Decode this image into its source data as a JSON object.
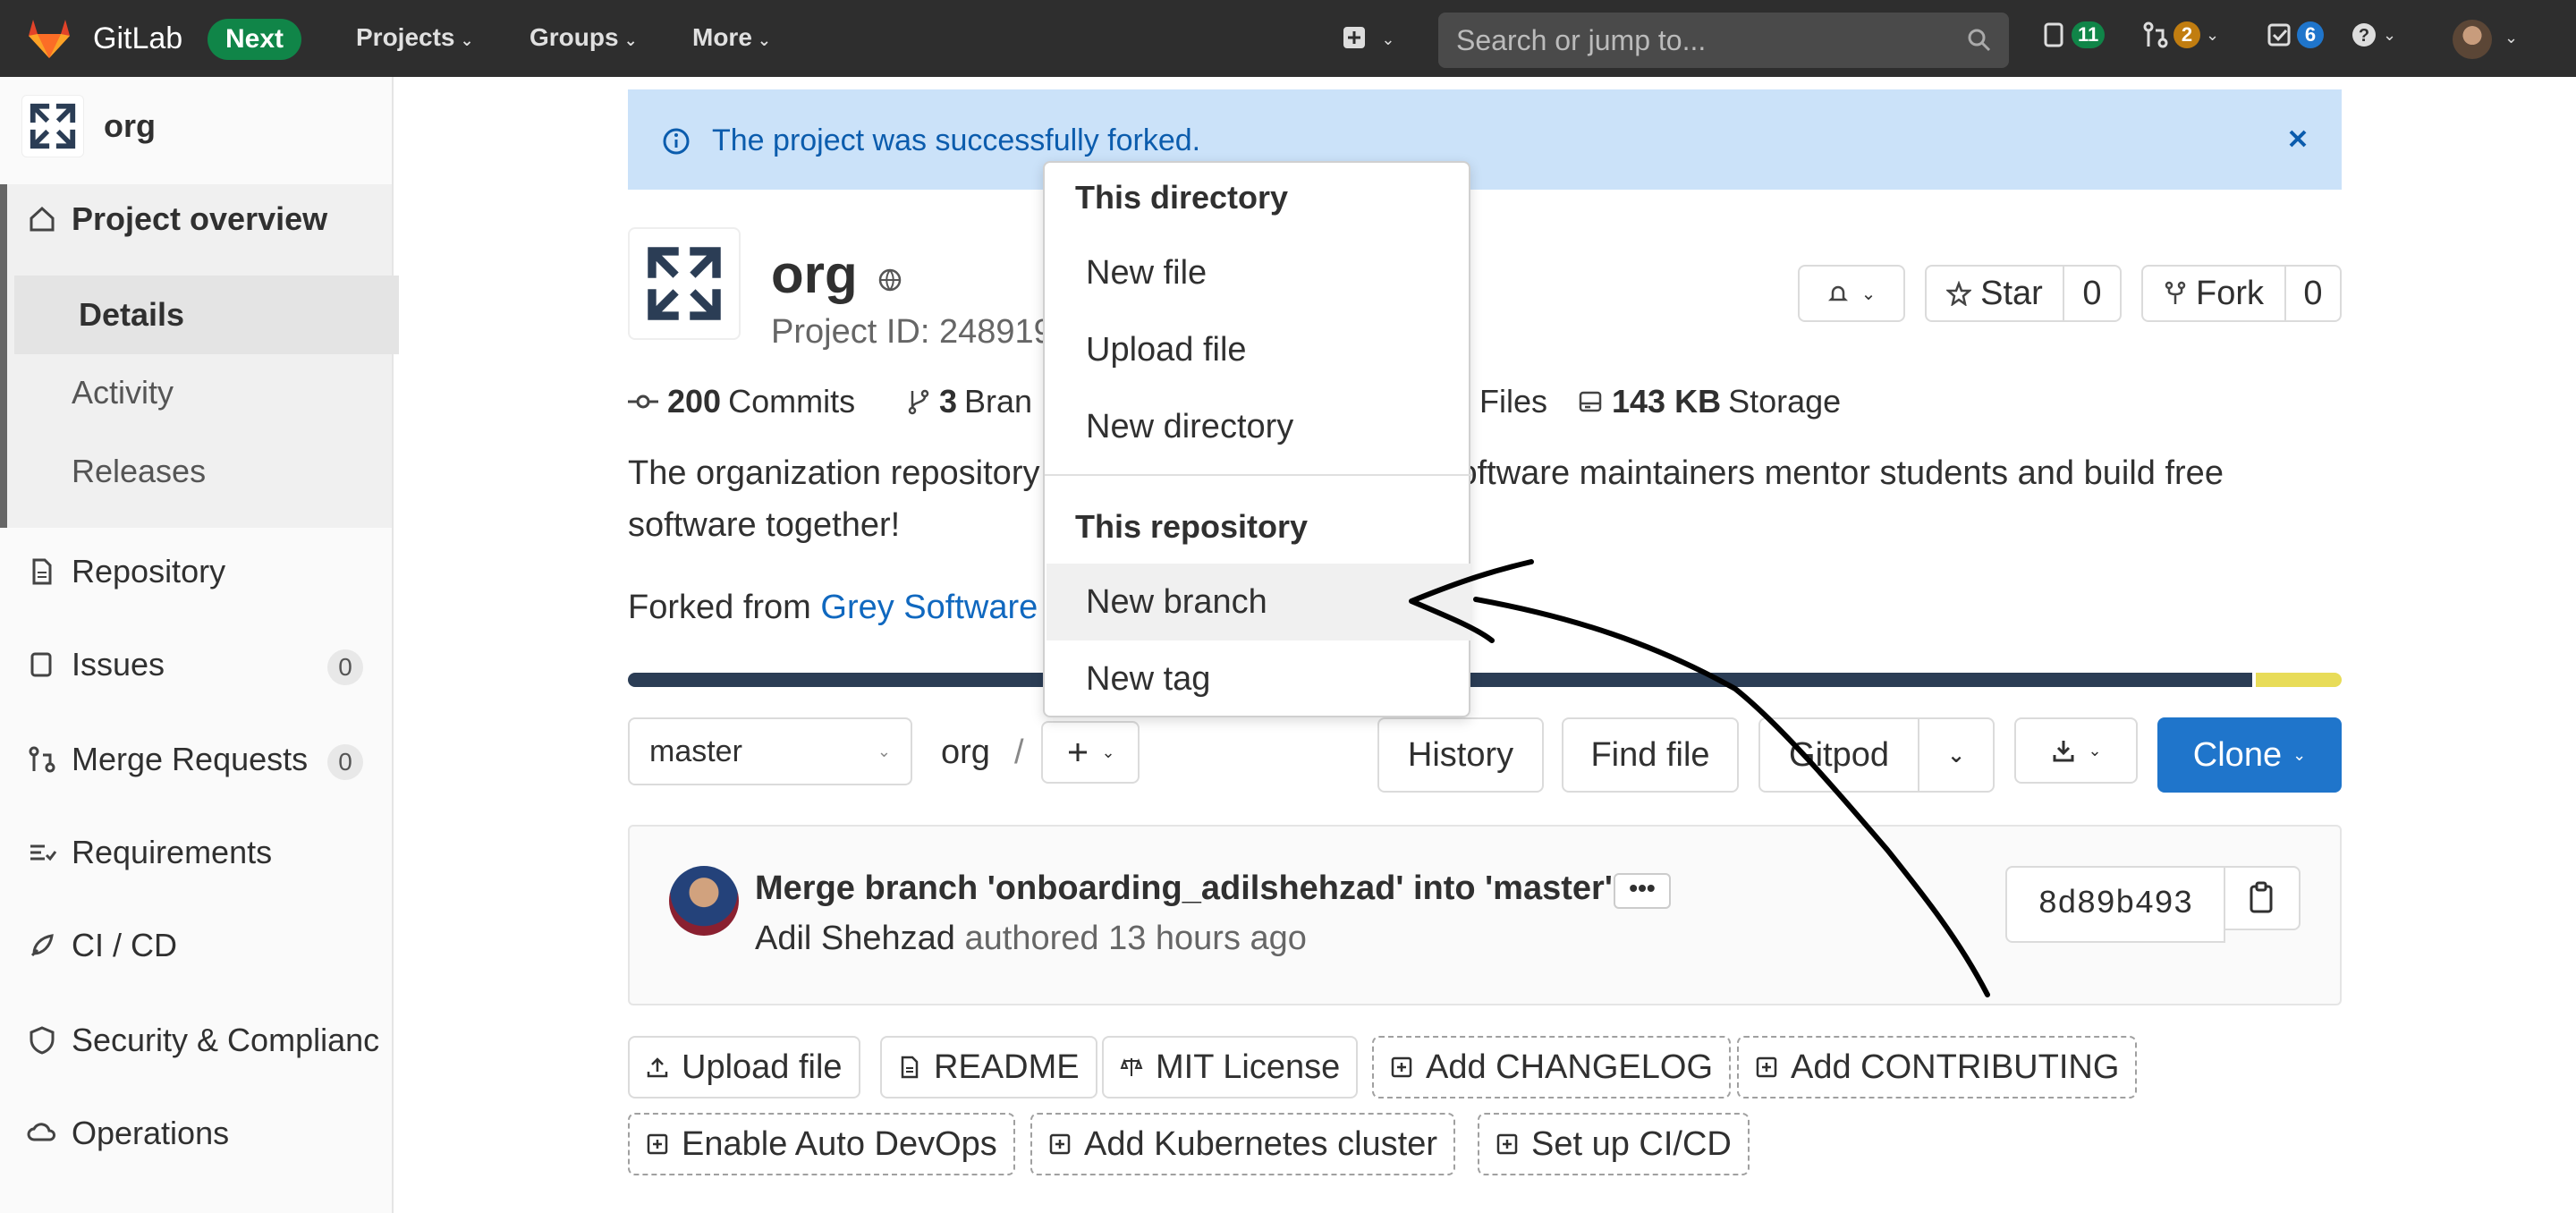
{
  "navbar": {
    "brand": "GitLab",
    "next_badge": "Next",
    "menus": [
      "Projects",
      "Groups",
      "More"
    ],
    "search_placeholder": "Search or jump to...",
    "issues_count": "11",
    "mr_count": "2",
    "todos_count": "6",
    "colors": {
      "bg": "#2e2e2e",
      "issues_badge": "#108548",
      "mr_badge": "#c17d10",
      "todos_badge": "#1f75cb"
    }
  },
  "sidebar": {
    "project_name": "org",
    "items": [
      {
        "label": "Project overview",
        "icon": "home-icon"
      },
      {
        "label": "Repository",
        "icon": "document-icon"
      },
      {
        "label": "Issues",
        "icon": "issues-icon",
        "count": "0"
      },
      {
        "label": "Merge Requests",
        "icon": "merge-request-icon",
        "count": "0"
      },
      {
        "label": "Requirements",
        "icon": "requirements-icon"
      },
      {
        "label": "CI / CD",
        "icon": "rocket-icon"
      },
      {
        "label": "Security & Complianc",
        "icon": "shield-icon"
      },
      {
        "label": "Operations",
        "icon": "cloud-gear-icon"
      }
    ],
    "subitems": [
      "Details",
      "Activity",
      "Releases"
    ]
  },
  "alert": {
    "message": "The project was successfully forked."
  },
  "project": {
    "title": "org",
    "id_label": "Project ID: 248919",
    "star_label": "Star",
    "star_count": "0",
    "fork_label": "Fork",
    "fork_count": "0",
    "stats": {
      "commits_count": "200",
      "commits_label": "Commits",
      "branches_count": "3",
      "branches_label": "Bran",
      "files_label": "Files",
      "storage_size": "143 KB",
      "storage_label": "Storage"
    },
    "description_part1": "The organization repository",
    "description_part2": "oftware maintainers mentor students and build free",
    "description_line2": "software together!",
    "forked_prefix": "Forked from ",
    "forked_link": "Grey Software"
  },
  "toolbar": {
    "branch": "master",
    "path": "org",
    "path_sep": "/",
    "add_icon": "plus-icon",
    "history": "History",
    "find_file": "Find file",
    "gitpod": "Gitpod",
    "clone": "Clone",
    "clone_color": "#1f75cb"
  },
  "commit": {
    "title": "Merge branch 'onboarding_adilshehzad' into 'master'",
    "ellipsis": "•••",
    "author": "Adil Shehzad",
    "meta": "authored 13 hours ago",
    "sha": "8d89b493"
  },
  "quick_actions": {
    "upload_file": "Upload file",
    "readme": "README",
    "mit_license": "MIT License",
    "add_changelog": "Add CHANGELOG",
    "add_contributing": "Add CONTRIBUTING",
    "enable_autodevops": "Enable Auto DevOps",
    "add_k8s": "Add Kubernetes cluster",
    "setup_cicd": "Set up CI/CD"
  },
  "dropdown": {
    "header_directory": "This directory",
    "new_file": "New file",
    "upload_file": "Upload file",
    "new_directory": "New directory",
    "header_repository": "This repository",
    "new_branch": "New branch",
    "new_tag": "New tag"
  },
  "language_bar": {
    "colors": [
      "#2b3d55",
      "#e8dc58"
    ],
    "fractions": [
      0.95,
      0.05
    ]
  }
}
